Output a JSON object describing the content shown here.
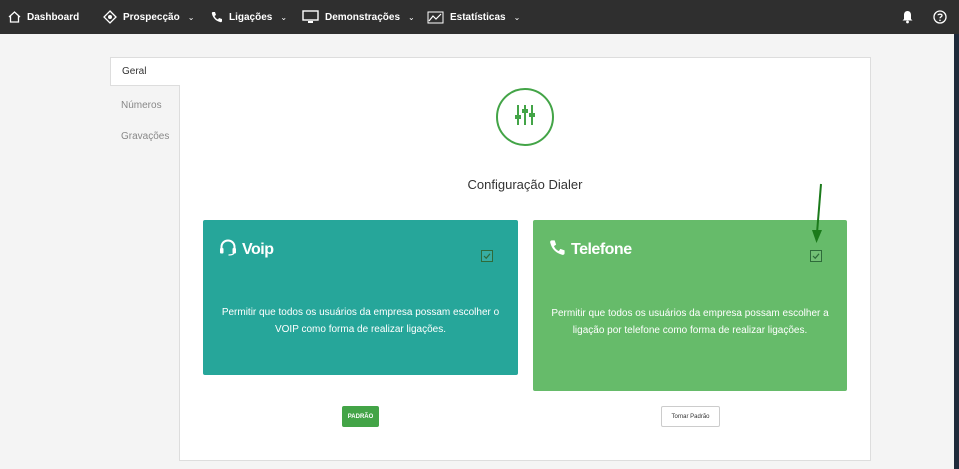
{
  "nav": {
    "dashboard": "Dashboard",
    "prospeccao": "Prospecção",
    "ligacoes": "Ligações",
    "demonstracoes": "Demonstrações",
    "estatisticas": "Estatísticas",
    "caret": "⌄"
  },
  "tabs": {
    "geral": "Geral",
    "numeros": "Números",
    "gravacoes": "Gravações"
  },
  "page": {
    "title": "Configuração Dialer"
  },
  "cards": {
    "voip": {
      "title": "Voip",
      "description": "Permitir que todos os usuários da empresa possam escolher o VOIP como forma de realizar ligações.",
      "checked": true
    },
    "telefone": {
      "title": "Telefone",
      "description": "Permitir que todos os usuários da empresa possam escolher a ligação por telefone como forma de realizar ligações.",
      "checked": true
    }
  },
  "buttons": {
    "default_label": "PADRÃO",
    "make_default_label": "Tornar Padrão"
  },
  "colors": {
    "topbar": "#2f2f2f",
    "voip_card": "#26a69a",
    "telefone_card": "#66bb6a",
    "accent_green": "#43a447",
    "annotation_arrow": "#1b7a1b"
  },
  "icons": {
    "dashboard": "home-icon",
    "prospeccao": "target-icon",
    "ligacoes": "phone-icon",
    "demonstracoes": "monitor-icon",
    "estatisticas": "chart-icon",
    "notifications": "bell-icon",
    "help": "help-icon",
    "settings": "sliders-icon",
    "voip": "headset-icon",
    "telefone": "phone-icon"
  }
}
